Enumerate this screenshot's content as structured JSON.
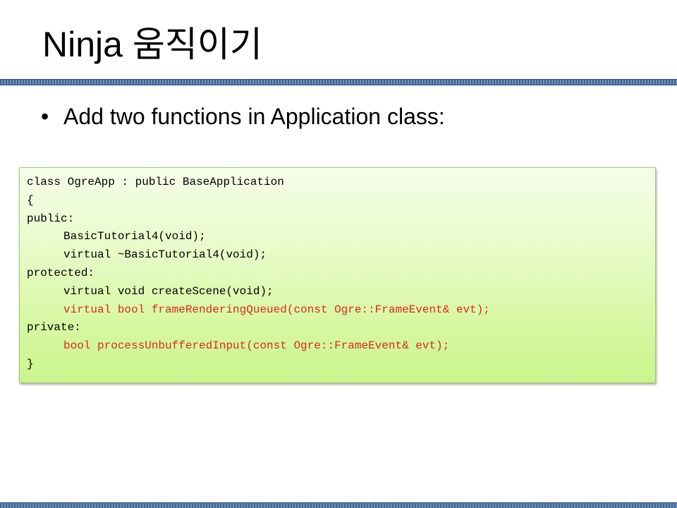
{
  "slide": {
    "title": "Ninja 움직이기",
    "bullet_glyph": "•",
    "bullet_text": "Add two functions in Application class:"
  },
  "code": {
    "lines": [
      {
        "text": "class OgreApp : public BaseApplication",
        "indent": false,
        "highlight": false
      },
      {
        "text": "{",
        "indent": false,
        "highlight": false
      },
      {
        "text": "public:",
        "indent": false,
        "highlight": false
      },
      {
        "text": "BasicTutorial4(void);",
        "indent": true,
        "highlight": false
      },
      {
        "text": "virtual ~BasicTutorial4(void);",
        "indent": true,
        "highlight": false
      },
      {
        "text": "protected:",
        "indent": false,
        "highlight": false
      },
      {
        "text": "virtual void createScene(void);",
        "indent": true,
        "highlight": false
      },
      {
        "text": "virtual bool frameRenderingQueued(const Ogre::FrameEvent& evt);",
        "indent": true,
        "highlight": true
      },
      {
        "text": "private:",
        "indent": false,
        "highlight": false
      },
      {
        "text": "bool processUnbufferedInput(const Ogre::FrameEvent& evt);",
        "indent": true,
        "highlight": true
      },
      {
        "text": "}",
        "indent": false,
        "highlight": false
      }
    ]
  },
  "colors": {
    "title_rule": "#3f6594",
    "highlight_text": "#e0271c",
    "code_box_top": "#f5fde9",
    "code_box_bottom": "#c9f58c"
  }
}
